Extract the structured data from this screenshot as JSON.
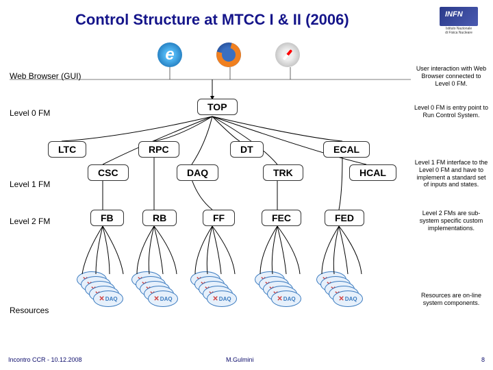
{
  "title": "Control Structure at MTCC I & II (2006)",
  "infn": {
    "logo_text": "INFN",
    "sub1": "Istituto Nazionale",
    "sub2": "di Fisica Nucleare"
  },
  "left_labels": {
    "browser": "Web Browser (GUI)",
    "l0": "Level 0 FM",
    "l1": "Level 1 FM",
    "l2": "Level 2 FM",
    "res": "Resources"
  },
  "annotations": {
    "browser": "User interaction with Web Browser connected to Level 0 FM.",
    "l0": "Level 0 FM is entry point to Run Control System.",
    "l1": "Level 1 FM interface to the Level 0 FM and have to implement a standard set of inputs and states.",
    "l2": "Level 2 FMs are sub-system specific custom implementations.",
    "res": "Resources are on-line system components."
  },
  "nodes": {
    "l0": "TOP",
    "l1": [
      "LTC",
      "CSC",
      "RPC",
      "DAQ",
      "DT",
      "TRK",
      "ECAL",
      "HCAL"
    ],
    "l2": [
      "FB",
      "RB",
      "FF",
      "FEC",
      "FED"
    ]
  },
  "resource_label": "DAQ",
  "footer": {
    "left": "Incontro CCR - 10.12.2008",
    "center": "M.Gulmini",
    "right": "8"
  }
}
